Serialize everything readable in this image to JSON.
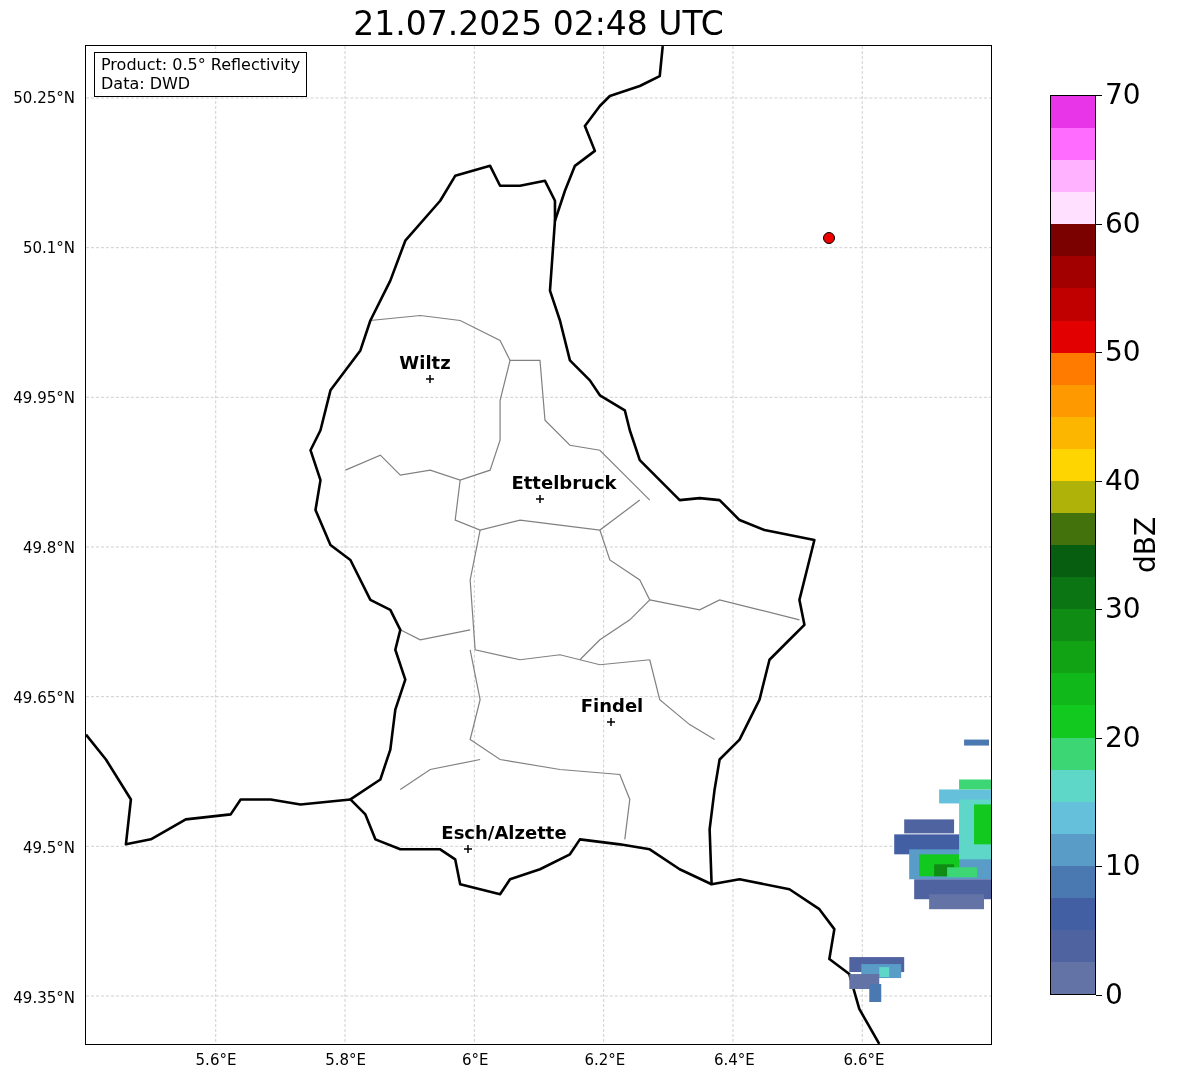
{
  "title": "21.07.2025 02:48 UTC",
  "info_box": [
    "Product: 0.5° Reflectivity",
    "Data: DWD"
  ],
  "lat_labels": [
    "50.25°N",
    "50.1°N",
    "49.95°N",
    "49.8°N",
    "49.65°N",
    "49.5°N",
    "49.35°N"
  ],
  "lon_labels": [
    "5.6°E",
    "5.8°E",
    "6°E",
    "6.2°E",
    "6.4°E",
    "6.6°E"
  ],
  "cities": [
    {
      "name": "Wiltz"
    },
    {
      "name": "Ettelbruck"
    },
    {
      "name": "Findel"
    },
    {
      "name": "Esch/Alzette"
    }
  ],
  "colorbar": {
    "label": "dBZ",
    "ticks": [
      "70",
      "60",
      "50",
      "40",
      "30",
      "20",
      "10",
      "0"
    ],
    "bands": [
      {
        "color": "#e835e8"
      },
      {
        "color": "#ff6cff"
      },
      {
        "color": "#ffb2ff"
      },
      {
        "color": "#ffe0ff"
      },
      {
        "color": "#7b0000"
      },
      {
        "color": "#a20000"
      },
      {
        "color": "#c00000"
      },
      {
        "color": "#e30000"
      },
      {
        "color": "#fe7b00"
      },
      {
        "color": "#fe9900"
      },
      {
        "color": "#fdb600"
      },
      {
        "color": "#fed500"
      },
      {
        "color": "#afb208"
      },
      {
        "color": "#43720d"
      },
      {
        "color": "#075e10"
      },
      {
        "color": "#0b7514"
      },
      {
        "color": "#0f8c14"
      },
      {
        "color": "#12a315"
      },
      {
        "color": "#10b81a"
      },
      {
        "color": "#12c91f"
      },
      {
        "color": "#3dd674"
      },
      {
        "color": "#5ed6c8"
      },
      {
        "color": "#65c0dc"
      },
      {
        "color": "#5a9cc8"
      },
      {
        "color": "#4a78b0"
      },
      {
        "color": "#435fa3"
      },
      {
        "color": "#4f63a0"
      },
      {
        "color": "#6473a5"
      }
    ]
  }
}
